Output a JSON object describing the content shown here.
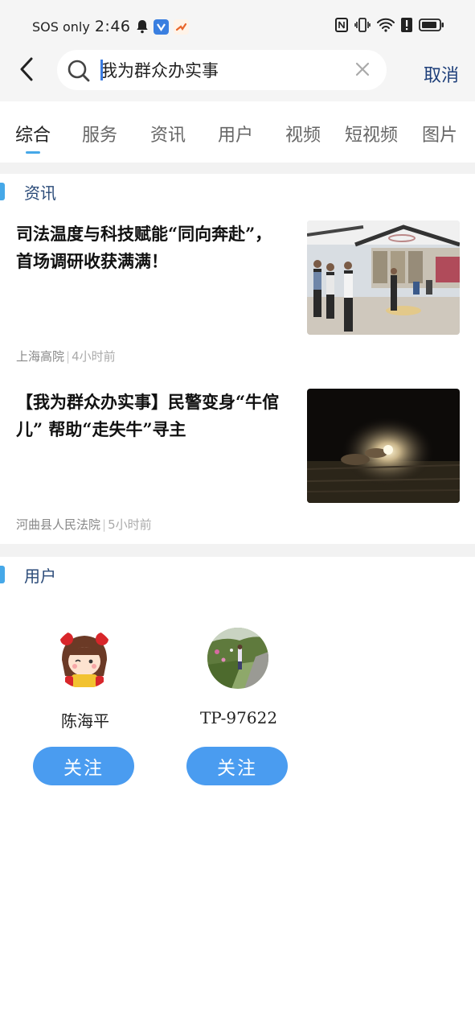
{
  "status_bar": {
    "carrier": "SOS only",
    "time": "2:46"
  },
  "search": {
    "query": "我为群众办实事",
    "cancel_label": "取消"
  },
  "tabs": [
    {
      "label": "综合",
      "active": true
    },
    {
      "label": "服务",
      "active": false
    },
    {
      "label": "资讯",
      "active": false
    },
    {
      "label": "用户",
      "active": false
    },
    {
      "label": "视频",
      "active": false
    },
    {
      "label": "短视频",
      "active": false
    },
    {
      "label": "图片",
      "active": false
    }
  ],
  "news_section": {
    "title": "资讯",
    "items": [
      {
        "title": "司法温度与科技赋能“同向奔赴”，首场调研收获满满！",
        "source": "上海高院",
        "separator": "|",
        "time": "4小时前",
        "thumb": "meeting-room-photo"
      },
      {
        "title": "【我为群众办实事】民警变身“牛倌儿” 帮助“走失牛”寻主",
        "source": "河曲县人民法院",
        "separator": "|",
        "time": "5小时前",
        "thumb": "night-field-photo"
      }
    ]
  },
  "users_section": {
    "title": "用户",
    "users": [
      {
        "name": "陈海平",
        "follow_label": "关注",
        "avatar": "cartoon-girl-avatar"
      },
      {
        "name": "TP-97622",
        "follow_label": "关注",
        "avatar": "landscape-avatar"
      }
    ]
  },
  "colors": {
    "accent": "#46a8e8",
    "follow_button": "#4a9cf0",
    "cancel_text": "#1e3f7a",
    "section_title": "#2a4a78"
  }
}
